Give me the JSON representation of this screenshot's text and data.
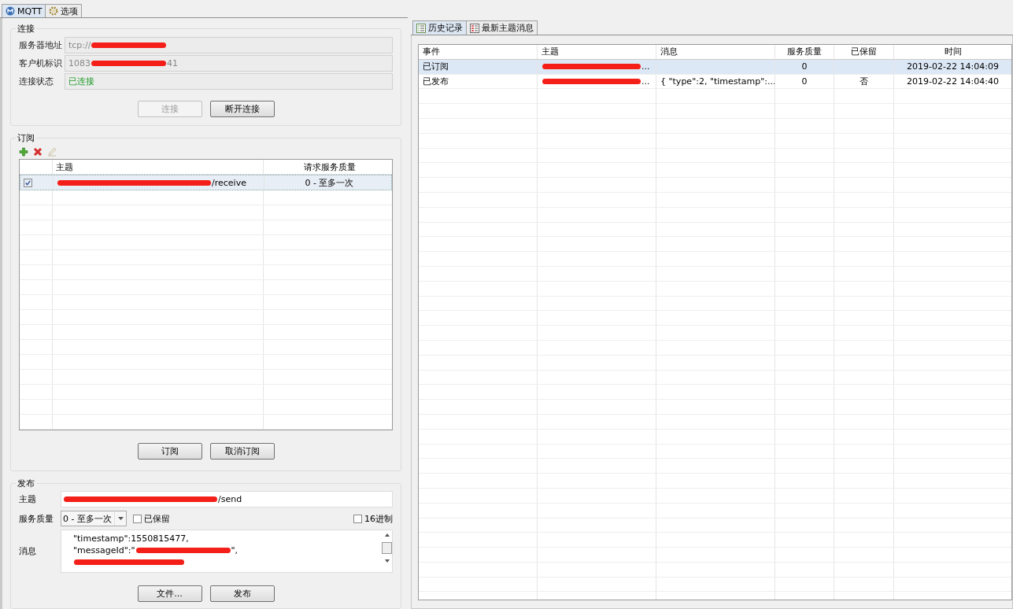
{
  "tabs": [
    {
      "label": "MQTT",
      "selected": true,
      "kind": "mqtt"
    },
    {
      "label": "选项",
      "selected": false,
      "kind": "gear"
    }
  ],
  "connection": {
    "title": "连接",
    "fields": [
      {
        "label": "服务器地址",
        "kind": "readonly",
        "parts": [
          {
            "kind": "text",
            "text": "tcp://"
          },
          {
            "kind": "redaction"
          }
        ]
      },
      {
        "label": "客户机标识",
        "kind": "readonly",
        "parts": [
          {
            "kind": "text",
            "text": "1083"
          },
          {
            "kind": "redaction"
          },
          {
            "kind": "text",
            "text": "41"
          }
        ]
      },
      {
        "label": "连接状态",
        "kind": "status",
        "parts": [
          {
            "kind": "text",
            "text": "已连接"
          }
        ]
      }
    ],
    "buttons": [
      {
        "label": "连接",
        "disabled": true
      },
      {
        "label": "断开连接",
        "disabled": false
      }
    ]
  },
  "subscriptions": {
    "title": "订阅",
    "toolbar": [
      {
        "kind": "add",
        "disabled": false
      },
      {
        "kind": "delete",
        "disabled": false
      },
      {
        "kind": "edit",
        "disabled": true
      }
    ],
    "columns": [
      "主题",
      "请求服务质量"
    ],
    "rows": [
      {
        "checked": true,
        "selected": true,
        "topic": [
          {
            "kind": "redaction"
          },
          {
            "kind": "text",
            "text": "/receive"
          }
        ],
        "qos": "0 - 至多一次"
      }
    ],
    "buttons": [
      {
        "label": "订阅",
        "disabled": false
      },
      {
        "label": "取消订阅",
        "disabled": false
      }
    ]
  },
  "publish": {
    "title": "发布",
    "topic_label": "主题",
    "topic": [
      {
        "kind": "redaction"
      },
      {
        "kind": "text",
        "text": "/send"
      }
    ],
    "qos_label": "服务质量",
    "qos": "0 - 至多一次",
    "retained": {
      "label": "已保留",
      "checked": false
    },
    "hex": {
      "label": "16进制",
      "checked": false
    },
    "message_label": "消息",
    "message_lines": [
      [
        {
          "kind": "text",
          "text": "\"timestamp\":1550815477,"
        }
      ],
      [
        {
          "kind": "text",
          "text": "\"messageId\":\""
        },
        {
          "kind": "redaction"
        },
        {
          "kind": "text",
          "text": "\","
        }
      ],
      [
        {
          "kind": "redaction"
        }
      ]
    ],
    "buttons": [
      {
        "label": "文件...",
        "disabled": false
      },
      {
        "label": "发布",
        "disabled": false
      }
    ]
  },
  "history_tabs": [
    {
      "label": "历史记录",
      "selected": true,
      "kind": "list"
    },
    {
      "label": "最新主题消息",
      "selected": false,
      "kind": "grid"
    }
  ],
  "history": {
    "columns": [
      "事件",
      "主题",
      "消息",
      "服务质量",
      "已保留",
      "时间"
    ],
    "rows": [
      {
        "selected": true,
        "event": "已订阅",
        "topic": [
          {
            "kind": "redaction"
          },
          {
            "kind": "text",
            "text": "..."
          }
        ],
        "message": "",
        "qos": "0",
        "retained": "",
        "time": "2019-02-22 14:04:09"
      },
      {
        "selected": false,
        "event": "已发布",
        "topic": [
          {
            "kind": "redaction"
          },
          {
            "kind": "text",
            "text": "..."
          }
        ],
        "message": "{     \"type\":2,     \"timestamp\":...",
        "qos": "0",
        "retained": "否",
        "time": "2019-02-22 14:04:40"
      }
    ]
  }
}
